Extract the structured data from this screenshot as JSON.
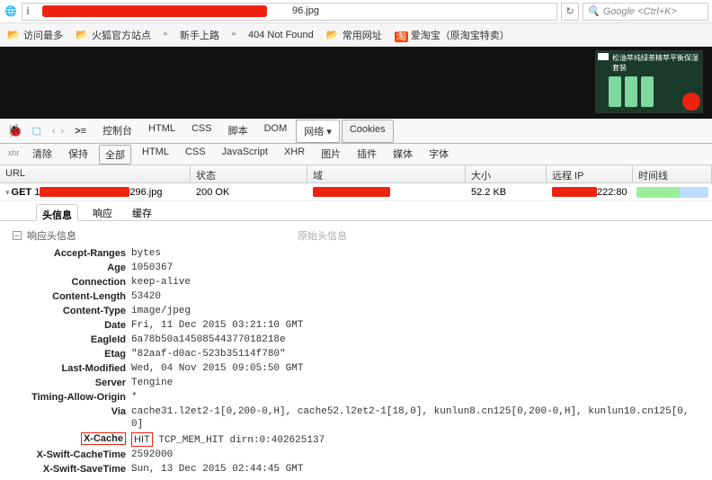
{
  "addr": {
    "globe": "🌐",
    "url_tail": "96.jpg",
    "refresh": "↻",
    "search_placeholder": "Google <Ctrl+K>",
    "search_icon": "🔍"
  },
  "bookmarks": [
    {
      "icon": "📂",
      "label": "访问最多"
    },
    {
      "icon": "📂",
      "label": "火狐官方站点"
    },
    {
      "icon": "▫",
      "label": "新手上路"
    },
    {
      "icon": "▫",
      "label": "404 Not Found"
    },
    {
      "icon": "📂",
      "label": "常用网址"
    },
    {
      "icon": "淘",
      "label": "爱淘宝（原淘宝特卖）"
    }
  ],
  "ad": {
    "text": "松油萃纯绿茶精萃平衡保湿套装"
  },
  "toolbar1": {
    "bug": "🐞",
    "console": ">≡",
    "tabs": [
      "控制台",
      "HTML",
      "CSS",
      "脚本",
      "DOM",
      "网络 ▾",
      "Cookies"
    ],
    "active": "网络 ▾",
    "boxed": "Cookies"
  },
  "toolbar2": {
    "xhr": "xhr",
    "items": [
      "清除",
      "保持",
      "全部",
      "HTML",
      "CSS",
      "JavaScript",
      "XHR",
      "图片",
      "插件",
      "媒体",
      "字体"
    ],
    "boxed": "全部"
  },
  "grid": {
    "headers": {
      "url": "URL",
      "status": "状态",
      "domain": "域",
      "size": "大小",
      "ip": "远程 IP",
      "time": "时间线"
    },
    "row": {
      "method": "GET",
      "tail": "296.jpg",
      "status": "200 OK",
      "size": "52.2 KB",
      "ip_tail": "222:80"
    }
  },
  "detail_tabs": [
    "头信息",
    "响应",
    "缓存"
  ],
  "panel_title": "响应头信息",
  "raw_label": "原始头信息",
  "headers": [
    {
      "name": "Accept-Ranges",
      "value": "bytes"
    },
    {
      "name": "Age",
      "value": "1050367"
    },
    {
      "name": "Connection",
      "value": "keep-alive"
    },
    {
      "name": "Content-Length",
      "value": "53420"
    },
    {
      "name": "Content-Type",
      "value": "image/jpeg"
    },
    {
      "name": "Date",
      "value": "Fri, 11 Dec 2015 03:21:10 GMT"
    },
    {
      "name": "EagleId",
      "value": "6a78b50a14508544377018218e"
    },
    {
      "name": "Etag",
      "value": "\"82aaf-d0ac-523b35114f780\""
    },
    {
      "name": "Last-Modified",
      "value": "Wed, 04 Nov 2015 09:05:50 GMT"
    },
    {
      "name": "Server",
      "value": "Tengine"
    },
    {
      "name": "Timing-Allow-Origin",
      "value": "*"
    },
    {
      "name": "Via",
      "value": "cache31.l2et2-1[0,200-0,H], cache52.l2et2-1[18,0], kunlun8.cn125[0,200-0,H], kunlun10.cn125[0,0]"
    },
    {
      "name": "X-Cache",
      "value": "HIT TCP_MEM_HIT dirn:0:402625137",
      "hl": true
    },
    {
      "name": "X-Swift-CacheTime",
      "value": "2592000"
    },
    {
      "name": "X-Swift-SaveTime",
      "value": "Sun, 13 Dec 2015 02:44:45 GMT"
    }
  ]
}
